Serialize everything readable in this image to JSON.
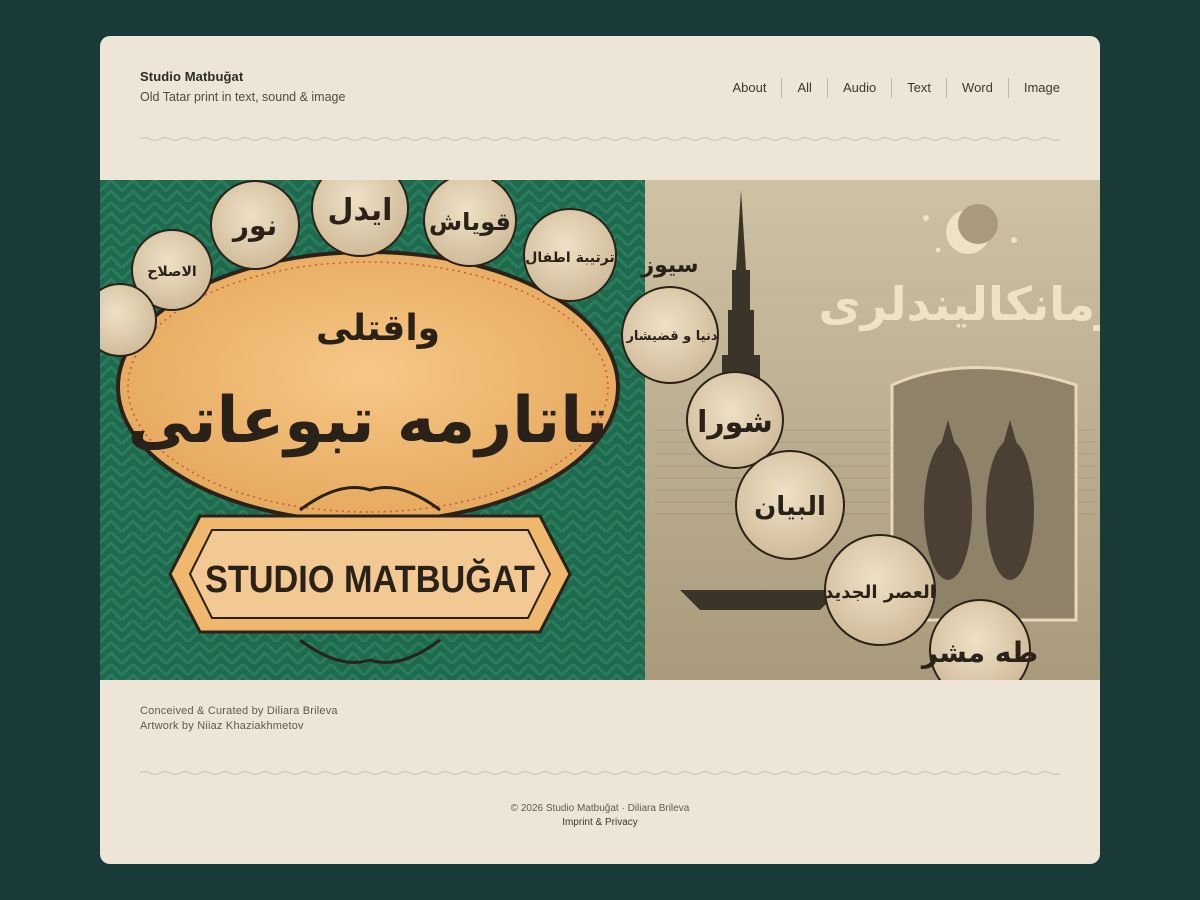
{
  "brand": {
    "title": "Studio Matbuğat",
    "subtitle": "Old Tatar print in text, sound & image"
  },
  "nav": {
    "items": [
      "About",
      "All",
      "Audio",
      "Text",
      "Word",
      "Image"
    ]
  },
  "hero": {
    "banner_text": "STUDIO MATBUĞAT",
    "arabic_small": "واقتلی",
    "arabic_large": "تاتارمه تبوعاتی",
    "arabic_right": "زمانکالیندلری",
    "medallions": [
      "نور",
      "ایدل",
      "قویاش",
      "ترتیبة اطفال",
      "سیوز",
      "الاصلاح",
      "دنیا و قضیشار",
      "شورا",
      "البیان",
      "العصر الجدید",
      "طه مشر"
    ]
  },
  "credits": {
    "line1": "Conceived & Curated by Diliara Brileva",
    "line2": "Artwork by Niiaz Khaziakhmetov"
  },
  "footer": {
    "copyright": "© 2026 Studio Matbuğat · Diliara Brileva",
    "imprint": "Imprint",
    "amp": "&",
    "privacy": "Privacy"
  },
  "colors": {
    "page_bg": "#193a39",
    "card_bg": "#ede6d6",
    "hero_green": "#1d6a4f",
    "hero_ochre": "#efb86e",
    "ink": "#2a2219"
  }
}
